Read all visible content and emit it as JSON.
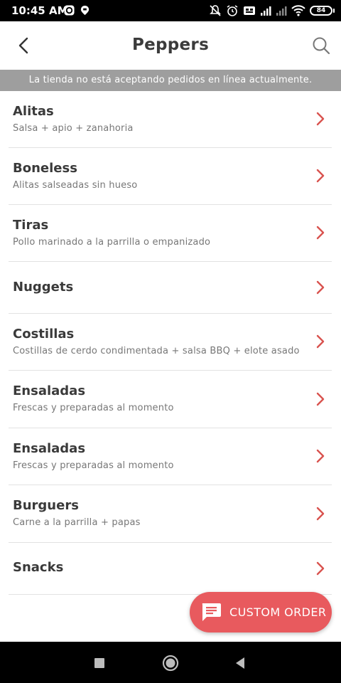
{
  "status_bar": {
    "time": "10:45 AM",
    "battery": "84"
  },
  "header": {
    "title": "Peppers",
    "icons": [
      "back-arrow-icon",
      "search-icon"
    ]
  },
  "notice": {
    "text": "La tienda no está aceptando pedidos en línea actualmente."
  },
  "categories": [
    {
      "title": "Alitas",
      "subtitle": "Salsa + apio + zanahoria"
    },
    {
      "title": "Boneless",
      "subtitle": "Alitas salseadas sin hueso"
    },
    {
      "title": "Tiras",
      "subtitle": "Pollo marinado a la parrilla o empanizado"
    },
    {
      "title": "Nuggets",
      "subtitle": ""
    },
    {
      "title": "Costillas",
      "subtitle": "Costillas de cerdo condimentada + salsa BBQ + elote asado"
    },
    {
      "title": "Ensaladas",
      "subtitle": "Frescas y preparadas al momento"
    },
    {
      "title": "Ensaladas",
      "subtitle": "Frescas y preparadas al momento"
    },
    {
      "title": "Burguers",
      "subtitle": "Carne a la parrilla + papas"
    },
    {
      "title": "Snacks",
      "subtitle": ""
    }
  ],
  "custom_order": {
    "label": "CUSTOM ORDER",
    "icon": "chat-bubble-icon"
  },
  "colors": {
    "accent": "#e85a5e",
    "chevron": "#d9534f",
    "banner": "#9e9e9e"
  }
}
